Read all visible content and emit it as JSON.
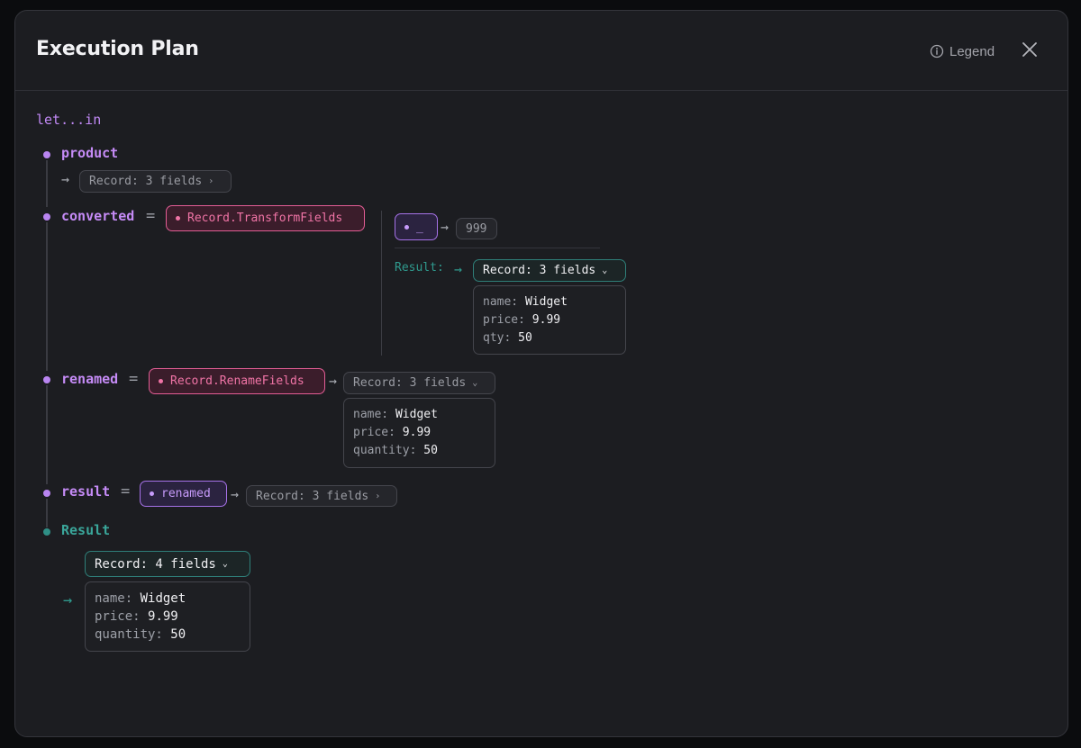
{
  "header": {
    "title": "Execution Plan",
    "legend_label": "Legend"
  },
  "plan": {
    "let_keyword": "let...in",
    "product": {
      "name": "product",
      "value": "Record: 3 fields"
    },
    "converted": {
      "name": "converted",
      "function": "Record.TransformFields",
      "lambda": "_",
      "lambda_value": "999",
      "result_label": "Result:",
      "result_value": "Record: 3 fields",
      "fields": [
        {
          "key": "name:",
          "value": "Widget"
        },
        {
          "key": "price:",
          "value": "9.99"
        },
        {
          "key": "qty:",
          "value": "50"
        }
      ]
    },
    "renamed": {
      "name": "renamed",
      "function": "Record.RenameFields",
      "result_value": "Record: 3 fields",
      "fields": [
        {
          "key": "name:",
          "value": "Widget"
        },
        {
          "key": "price:",
          "value": "9.99"
        },
        {
          "key": "quantity:",
          "value": "50"
        }
      ]
    },
    "result": {
      "name": "result",
      "reference": "renamed",
      "value": "Record: 3 fields"
    },
    "final": {
      "label": "Result",
      "value": "Record: 4 fields",
      "fields": [
        {
          "key": "name:",
          "value": "Widget"
        },
        {
          "key": "price:",
          "value": "9.99"
        },
        {
          "key": "quantity:",
          "value": "50"
        }
      ]
    }
  },
  "colors": {
    "variable": "#c58bf6",
    "function_pink": "#f074a6",
    "reference_purple": "#c79bfb",
    "result_teal": "#2f9a8e",
    "background": "#1c1d21"
  },
  "icons": {
    "legend": "info-circle-icon",
    "close": "close-icon",
    "expand": "chevron-down-icon",
    "collapsed": "chevron-right-icon"
  }
}
